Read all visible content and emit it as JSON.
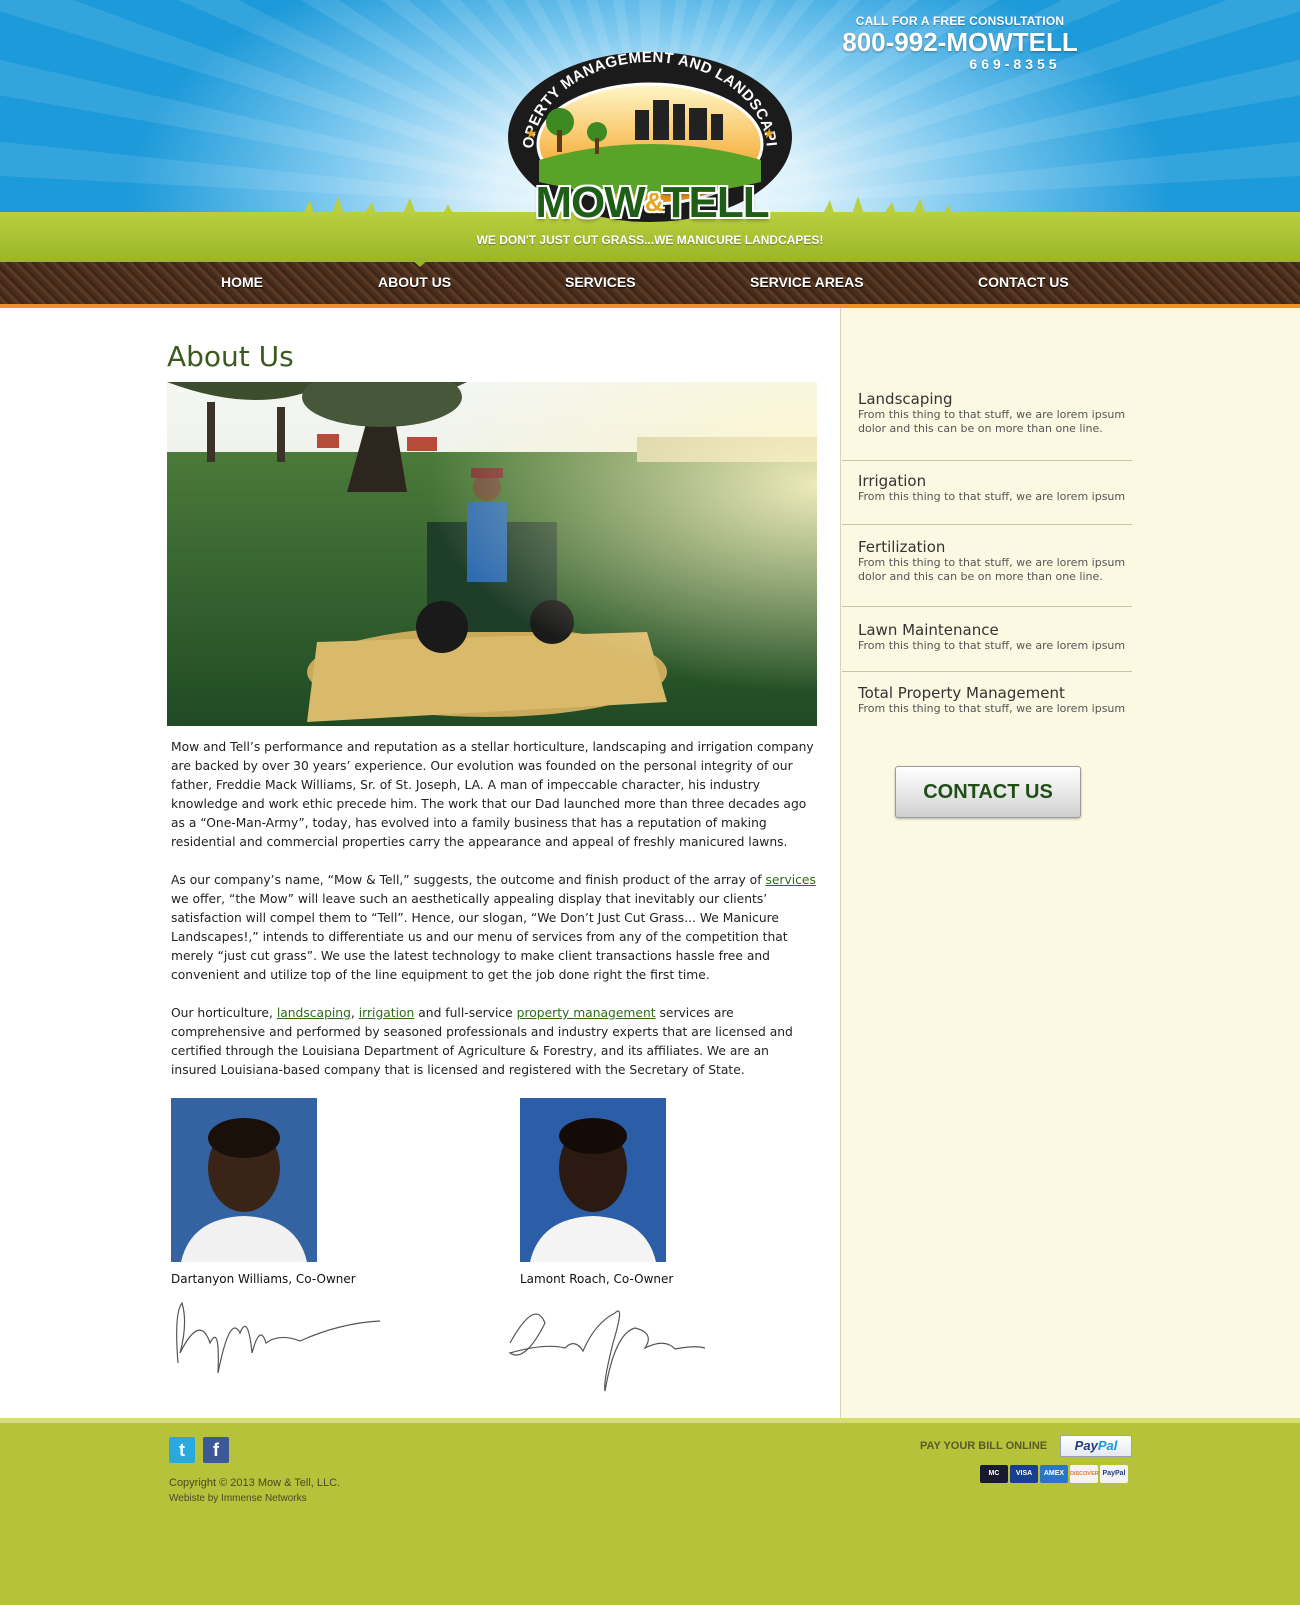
{
  "header": {
    "cta": "CALL FOR A FREE CONSULTATION",
    "phone": "800-992-MOWTELL",
    "phone_alt": "669-8355",
    "logo_arc_text": "PROPERTY MANAGEMENT AND LANDSCAPING",
    "logo_word_left": "MOW",
    "logo_amp": "&",
    "logo_word_right": "TELL",
    "slogan": "WE DON'T JUST CUT GRASS...WE MANICURE LANDCAPES!"
  },
  "nav": {
    "items": [
      {
        "label": "HOME"
      },
      {
        "label": "ABOUT US",
        "active": true
      },
      {
        "label": "SERVICES"
      },
      {
        "label": "SERVICE AREAS"
      },
      {
        "label": "CONTACT US"
      }
    ]
  },
  "main": {
    "title": "About Us",
    "paragraphs": {
      "p1": "Mow and Tell’s performance and reputation as a stellar horticulture, landscaping and irrigation company are backed by over 30 years’ experience. Our evolution was founded on the personal integrity of our father, Freddie Mack Williams, Sr. of St. Joseph, LA. A man of impeccable character, his industry knowledge and work ethic precede him. The work that our Dad launched more than three decades ago as a “One-Man-Army”, today, has evolved into a family business that has a reputation of making residential and commercial properties carry the appearance and appeal of freshly manicured lawns.",
      "p2_a": "As our company’s name, “Mow & Tell,” suggests, the outcome and finish product of the array of ",
      "p2_link": "services",
      "p2_b": " we offer, “the Mow” will leave such an aesthetically appealing display that inevitably our clients’ satisfaction will compel them to “Tell”. Hence, our slogan, “We Don’t Just Cut Grass... We Manicure Landscapes!,” intends to differentiate us and our menu of services from any of the competition that merely “just cut grass”. We use the latest technology to make client transactions hassle free and convenient and utilize top of the line equipment to get the job done right the first time.",
      "p3_a": "Our horticulture, ",
      "p3_link1": "landscaping",
      "p3_sep": ", ",
      "p3_link2": "irrigation",
      "p3_b": " and full-service ",
      "p3_link3": "property management",
      "p3_c": " services are comprehensive and performed by seasoned professionals and industry experts that are licensed and certified through the Louisiana Department of Agriculture & Forestry, and its affiliates. We are an insured Louisiana-based company that is licensed and registered with the Secretary of State."
    },
    "owners": [
      {
        "name": "Dartanyon Williams, Co-Owner"
      },
      {
        "name": "Lamont Roach, Co-Owner"
      }
    ]
  },
  "sidebar": {
    "services": [
      {
        "title": "Landscaping",
        "desc": "From this thing to that stuff, we are lorem ipsum dolor and this can be on more than one line."
      },
      {
        "title": "Irrigation",
        "desc": "From this thing to that stuff, we are lorem ipsum"
      },
      {
        "title": "Fertilization",
        "desc": "From this thing to that stuff, we are lorem ipsum dolor and this can be on more than one line."
      },
      {
        "title": "Lawn Maintenance",
        "desc": "From this thing to that stuff, we are lorem ipsum"
      },
      {
        "title": "Total Property Management",
        "desc": "From this thing to that stuff, we are lorem ipsum"
      }
    ],
    "contact_button": "CONTACT US"
  },
  "footer": {
    "twitter_icon": "t",
    "facebook_icon": "f",
    "copyright": "Copyright © 2013 Mow & Tell, LLC.",
    "credit": "Webiste by Immense Networks",
    "pay_label": "PAY YOUR BILL ONLINE",
    "paypal_pay": "Pay",
    "paypal_pal": "Pal",
    "cards": [
      {
        "label": "MC",
        "color": "#1a1a2e"
      },
      {
        "label": "VISA",
        "color": "#1a3f8f"
      },
      {
        "label": "AMEX",
        "color": "#2a76c4"
      },
      {
        "label": "DISCOVER",
        "color": "#f3f3f3"
      },
      {
        "label": "PayPal",
        "color": "#f3f3f3"
      }
    ]
  },
  "colors": {
    "sky": "#1d9ad9",
    "grass": "#b5c23a",
    "nav_dirt": "#4a2e1d",
    "nav_border": "#e8912d",
    "title_green": "#3b5a1e",
    "sidebar_bg": "#fcf9e3"
  }
}
